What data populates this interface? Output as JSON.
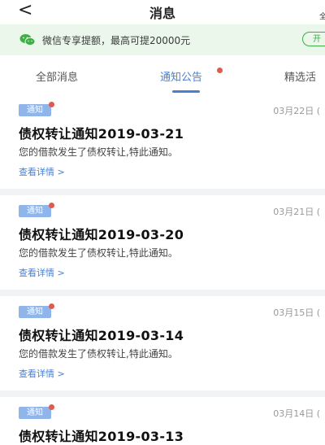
{
  "nav": {
    "back_glyph": "<",
    "title": "消息",
    "right_text": "全"
  },
  "banner": {
    "icon": "wechat-icon",
    "text": "微信专享提额，最高可提20000元",
    "button_label": "开"
  },
  "tabs": [
    {
      "label": "全部消息",
      "active": false
    },
    {
      "label": "通知公告",
      "active": true,
      "has_dot": true
    },
    {
      "label": "精选活",
      "active": false
    }
  ],
  "notices": [
    {
      "badge": "通知",
      "date": "03月22日 (",
      "title": "债权转让通知2019-03-21",
      "desc": "您的借款发生了债权转让,特此通知。",
      "link": "查看详情 >"
    },
    {
      "badge": "通知",
      "date": "03月21日 (",
      "title": "债权转让通知2019-03-20",
      "desc": "您的借款发生了债权转让,特此通知。",
      "link": "查看详情 >"
    },
    {
      "badge": "通知",
      "date": "03月15日 (",
      "title": "债权转让通知2019-03-14",
      "desc": "您的借款发生了债权转让,特此通知。",
      "link": "查看详情 >"
    },
    {
      "badge": "通知",
      "date": "03月14日 (",
      "title": "债权转让通知2019-03-13",
      "desc": "",
      "link": ""
    }
  ],
  "colors": {
    "accent": "#4a7fd0",
    "badge_bg": "#8fb5ea",
    "dot": "#e25a4b",
    "wechat_green": "#3cb043",
    "banner_bg": "#eaf7ea"
  }
}
